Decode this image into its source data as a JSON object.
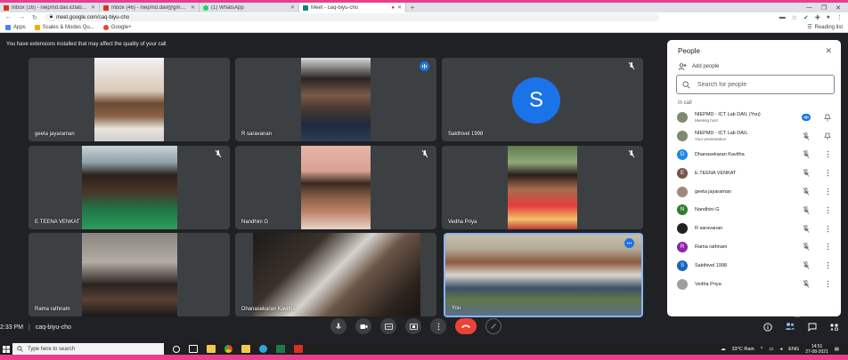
{
  "browser": {
    "tabs": [
      {
        "label": "Inbox (16) - niepmd.dail.ictlab@...",
        "color": "#d93025"
      },
      {
        "label": "Inbox (46) - niepmd.dail@gmail...",
        "color": "#d93025"
      },
      {
        "label": "(1) WhatsApp",
        "color": "#25d366"
      },
      {
        "label": "Meet - caq-biyu-cho",
        "color": "#00897b"
      }
    ],
    "url": "meet.google.com/caq-biyu-cho",
    "bookmarks": {
      "apps": "Apps",
      "scales": "Scales & Modes Qu...",
      "google": "Google+"
    },
    "reading_list": "Reading list"
  },
  "meet": {
    "extension_warning": "You have extensions installed that may affect the quality of your call",
    "tiles": [
      {
        "name": "geeta jayaraman"
      },
      {
        "name": "R saravanan"
      },
      {
        "name": "Sakthivel 1998",
        "avatar_letter": "S"
      },
      {
        "name": "E.TEENA VENKAT"
      },
      {
        "name": "Nandhini G"
      },
      {
        "name": "Vedha Priya"
      },
      {
        "name": "Rama rathnam"
      },
      {
        "name": "Dhanasekaran Kavitha"
      },
      {
        "name": "You"
      }
    ],
    "time": "2:33 PM",
    "meeting_code": "caq-biyu-cho",
    "people_badge": "10"
  },
  "people_panel": {
    "title": "People",
    "add_people": "Add people",
    "search_placeholder": "Search for people",
    "in_call_label": "In call",
    "participants": [
      {
        "name": "NIEPMD - ICT Lab DAIL (You)",
        "sub": "Meeting host",
        "avatar": "",
        "color": "#7d8a6f",
        "mic": "speaking",
        "second": "pin"
      },
      {
        "name": "NIEPMD - ICT Lab DAIL",
        "sub": "Your presentation",
        "avatar": "",
        "color": "#7d8a6f",
        "mic": "muted",
        "second": "pin"
      },
      {
        "name": "Dhanasekaran Kavitha",
        "sub": "",
        "avatar": "D",
        "color": "#1e88e5",
        "mic": "muted",
        "second": "more"
      },
      {
        "name": "E.TEENA VENKAT",
        "sub": "",
        "avatar": "E",
        "color": "#795548",
        "mic": "muted",
        "second": "more"
      },
      {
        "name": "geeta jayaraman",
        "sub": "",
        "avatar": "",
        "color": "#a1887f",
        "mic": "muted",
        "second": "more"
      },
      {
        "name": "Nandhini G",
        "sub": "",
        "avatar": "N",
        "color": "#2e7d32",
        "mic": "muted",
        "second": "more"
      },
      {
        "name": "R saravanan",
        "sub": "",
        "avatar": "",
        "color": "#202124",
        "mic": "muted",
        "second": "more"
      },
      {
        "name": "Rama rathnam",
        "sub": "",
        "avatar": "R",
        "color": "#8e24aa",
        "mic": "muted",
        "second": "more"
      },
      {
        "name": "Sakthivel 1998",
        "sub": "",
        "avatar": "S",
        "color": "#1565c0",
        "mic": "muted",
        "second": "more"
      },
      {
        "name": "Vedha Priya",
        "sub": "",
        "avatar": "",
        "color": "#9e9e9e",
        "mic": "muted",
        "second": "more"
      }
    ]
  },
  "taskbar": {
    "search_placeholder": "Type here to search",
    "weather": "33°C Rain",
    "lang": "ENG",
    "time": "14:51",
    "date": "27-08-2021"
  }
}
